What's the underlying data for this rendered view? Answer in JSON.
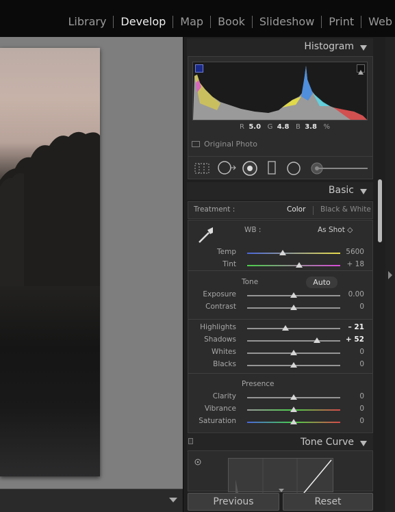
{
  "modules": [
    "Library",
    "Develop",
    "Map",
    "Book",
    "Slideshow",
    "Print",
    "Web"
  ],
  "active_module": "Develop",
  "histogram": {
    "title": "Histogram",
    "r_label": "R",
    "r_value": "5.0",
    "g_label": "G",
    "g_value": "4.8",
    "b_label": "B",
    "b_value": "3.8",
    "unit": "%",
    "original_photo_label": "Original Photo"
  },
  "tool_icons": [
    "crop-overlay-icon",
    "spot-removal-icon",
    "red-eye-icon",
    "graduated-filter-icon",
    "radial-filter-icon",
    "adjustment-brush-icon"
  ],
  "basic": {
    "title": "Basic",
    "treatment_label": "Treatment :",
    "color_label": "Color",
    "bw_label": "Black & White",
    "wb_label": "WB :",
    "wb_value": "As Shot ◇",
    "temp": {
      "label": "Temp",
      "value": "5600",
      "position": 0.38
    },
    "tint": {
      "label": "Tint",
      "value": "+ 18",
      "position": 0.56
    },
    "tone_label": "Tone",
    "auto_label": "Auto",
    "exposure": {
      "label": "Exposure",
      "value": "0.00",
      "position": 0.5
    },
    "contrast": {
      "label": "Contrast",
      "value": "0",
      "position": 0.5
    },
    "highlights": {
      "label": "Highlights",
      "value": "– 21",
      "position": 0.41
    },
    "shadows": {
      "label": "Shadows",
      "value": "+ 52",
      "position": 0.75
    },
    "whites": {
      "label": "Whites",
      "value": "0",
      "position": 0.5
    },
    "blacks": {
      "label": "Blacks",
      "value": "0",
      "position": 0.5
    },
    "presence_label": "Presence",
    "clarity": {
      "label": "Clarity",
      "value": "0",
      "position": 0.5
    },
    "vibrance": {
      "label": "Vibrance",
      "value": "0",
      "position": 0.5
    },
    "saturation": {
      "label": "Saturation",
      "value": "0",
      "position": 0.5
    }
  },
  "tone_curve": {
    "title": "Tone Curve"
  },
  "buttons": {
    "previous": "Previous",
    "reset": "Reset"
  },
  "colors": {
    "accent_text": "#f2f2f2",
    "panel": "#2c2c2c"
  }
}
